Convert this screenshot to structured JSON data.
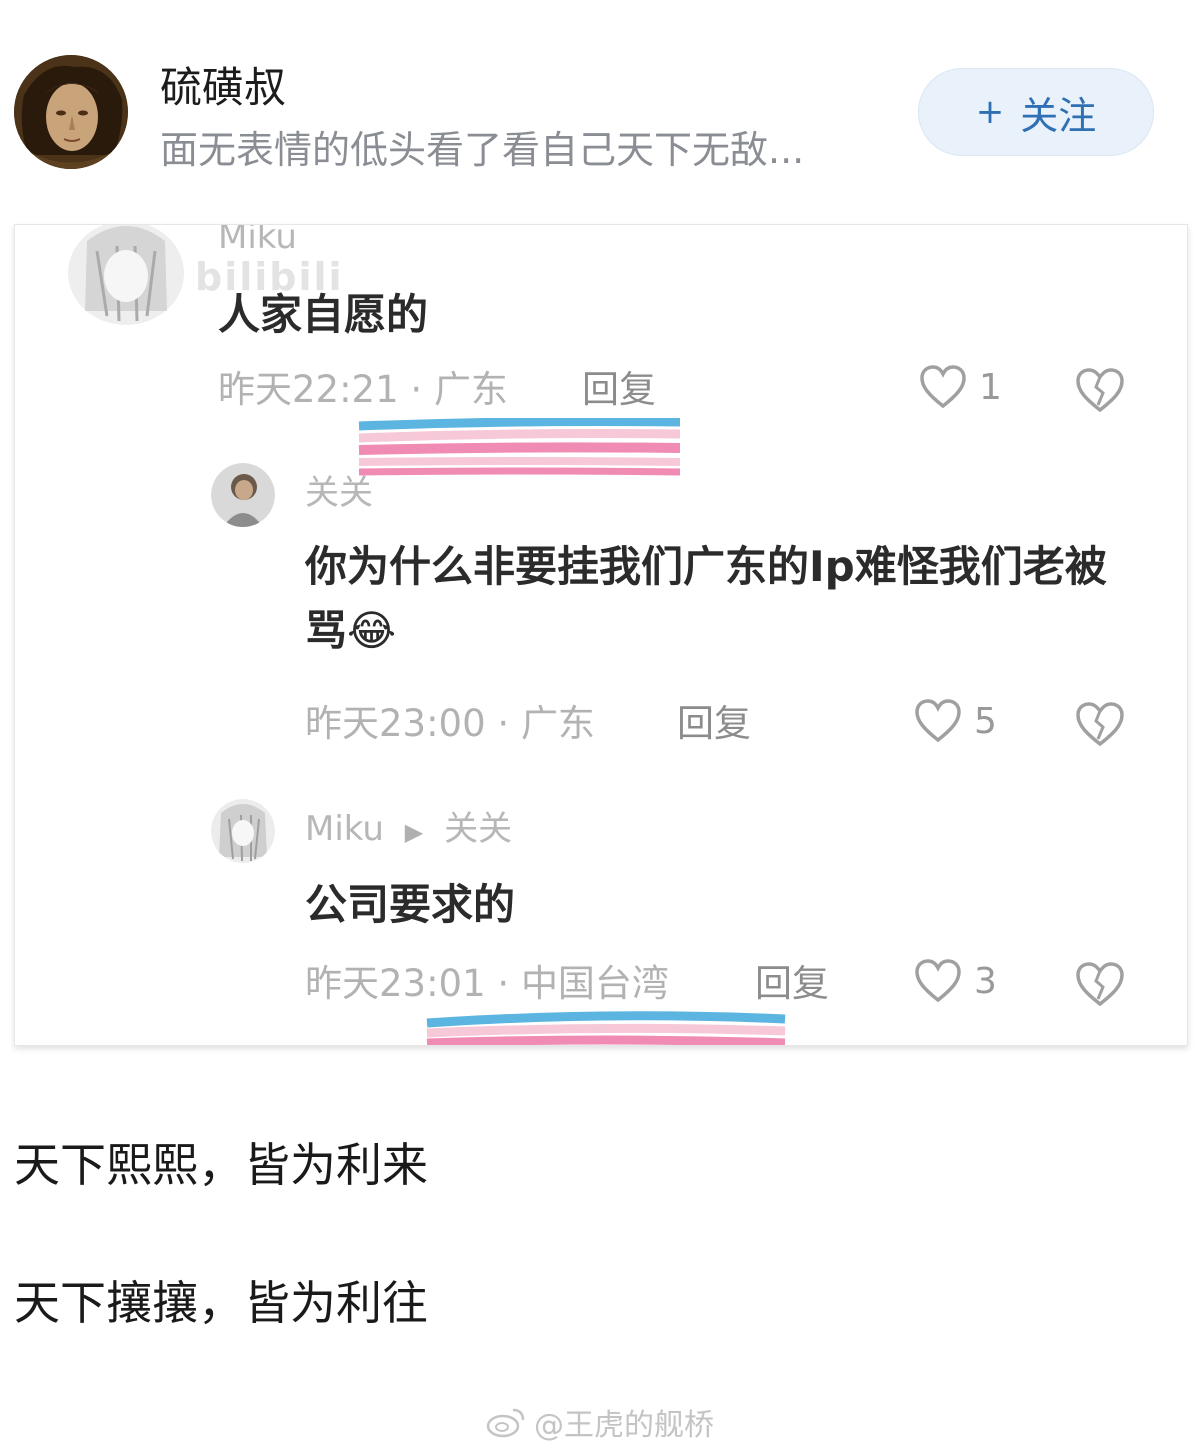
{
  "author": {
    "name": "硫磺叔",
    "bio": "面无表情的低头看了看自己天下无敌...",
    "avatar_icon": "portrait-avatar"
  },
  "follow_button": {
    "plus": "+",
    "label": "关注"
  },
  "screenshot": {
    "watermark": "bilibili",
    "comments": [
      {
        "name": "Miku",
        "text": "人家自愿的",
        "time": "昨天22:21",
        "location": "广东",
        "reply_label": "回复",
        "likes": "1"
      },
      {
        "name": "关关",
        "text": "你为什么非要挂我们广东的Ip难怪我们老被骂😂",
        "time": "昨天23:00",
        "location": "广东",
        "reply_label": "回复",
        "likes": "5"
      },
      {
        "name": "Miku",
        "arrow": "▶",
        "reply_to": "关关",
        "text": "公司要求的",
        "time": "昨天23:01",
        "location": "中国台湾",
        "reply_label": "回复",
        "likes": "3"
      }
    ],
    "separator": "·"
  },
  "poem": {
    "line1": "天下熙熙，皆为利来",
    "line2": "天下攘攘，皆为利往"
  },
  "footer": {
    "watermark": "@王虎的舰桥"
  },
  "colors": {
    "follow_bg": "#e9f1fa",
    "follow_text": "#2f6fb3",
    "stripe_blue": "#5bb5e0",
    "stripe_pink": "#f08bb4"
  }
}
